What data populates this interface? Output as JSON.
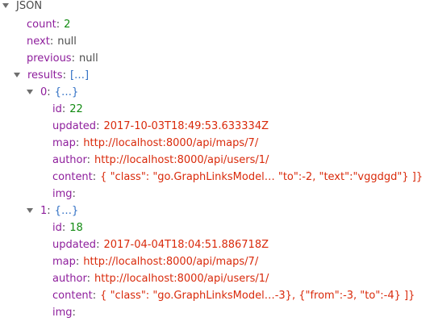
{
  "root": {
    "label": "JSON"
  },
  "sep": ":",
  "count": {
    "key": "count",
    "value": "2"
  },
  "next": {
    "key": "next",
    "value": "null"
  },
  "previous": {
    "key": "previous",
    "value": "null"
  },
  "results": {
    "key": "results",
    "summary": "[…]",
    "items": [
      {
        "index": "0",
        "summary": "{…}",
        "id": {
          "key": "id",
          "value": "22"
        },
        "updated": {
          "key": "updated",
          "value": "2017-10-03T18:49:53.633334Z"
        },
        "map": {
          "key": "map",
          "value": "http://localhost:8000/api/maps/7/"
        },
        "author": {
          "key": "author",
          "value": "http://localhost:8000/api/users/1/"
        },
        "content": {
          "key": "content",
          "value": "{ \"class\": \"go.GraphLinksModel… \"to\":-2, \"text\":\"vggdgd\"} ]}"
        },
        "img": {
          "key": "img",
          "value": ""
        }
      },
      {
        "index": "1",
        "summary": "{…}",
        "id": {
          "key": "id",
          "value": "18"
        },
        "updated": {
          "key": "updated",
          "value": "2017-04-04T18:04:51.886718Z"
        },
        "map": {
          "key": "map",
          "value": "http://localhost:8000/api/maps/7/"
        },
        "author": {
          "key": "author",
          "value": "http://localhost:8000/api/users/1/"
        },
        "content": {
          "key": "content",
          "value": "{ \"class\": \"go.GraphLinksModel…-3}, {\"from\":-3, \"to\":-4} ]}"
        },
        "img": {
          "key": "img",
          "value": ""
        }
      }
    ]
  },
  "colors": {
    "key": "#8e1e9c",
    "number": "#128b12",
    "string": "#d92a0b",
    "object_summary": "#2f6fc4"
  }
}
